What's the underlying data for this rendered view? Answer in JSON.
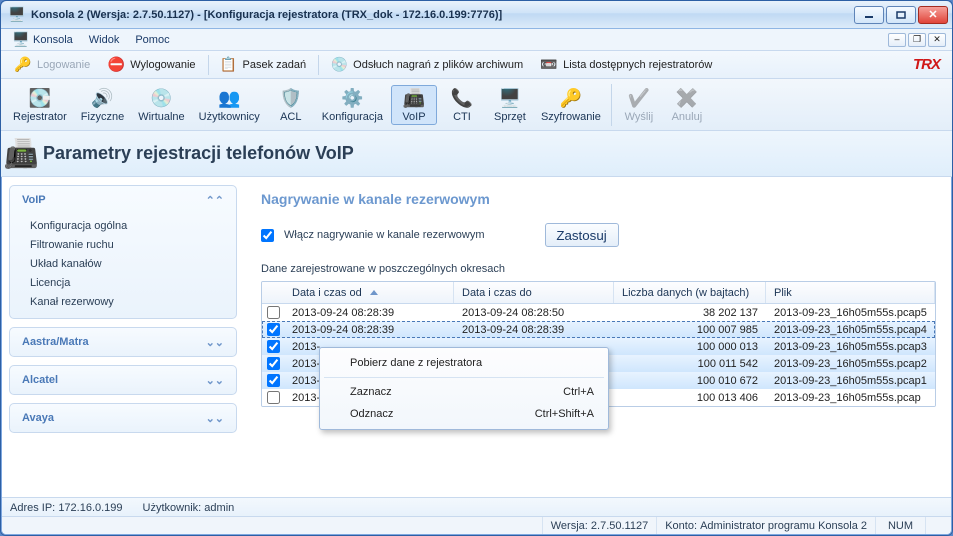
{
  "title": "Konsola 2 (Wersja:  2.7.50.1127) - [Konfiguracja rejestratora (TRX_dok - 172.16.0.199:7776)]",
  "menu": {
    "konsola": "Konsola",
    "widok": "Widok",
    "pomoc": "Pomoc"
  },
  "tb1": {
    "logowanie": "Logowanie",
    "wylogowanie": "Wylogowanie",
    "pasek": "Pasek zadań",
    "odsluch": "Odsłuch nagrań z plików archiwum",
    "lista": "Lista dostępnych rejestratorów"
  },
  "brand": "TRX",
  "tb2_items": [
    {
      "k": "rejestrator",
      "label": "Rejestrator",
      "ic": "💽"
    },
    {
      "k": "fizyczne",
      "label": "Fizyczne",
      "ic": "🔊"
    },
    {
      "k": "wirtualne",
      "label": "Wirtualne",
      "ic": "💿"
    },
    {
      "k": "uzytkownicy",
      "label": "Użytkownicy",
      "ic": "👥"
    },
    {
      "k": "acl",
      "label": "ACL",
      "ic": "🛡️"
    },
    {
      "k": "konfiguracja",
      "label": "Konfiguracja",
      "ic": "⚙️"
    },
    {
      "k": "voip",
      "label": "VoIP",
      "ic": "📠",
      "sel": true
    },
    {
      "k": "cti",
      "label": "CTI",
      "ic": "📞"
    },
    {
      "k": "sprzet",
      "label": "Sprzęt",
      "ic": "🖥️"
    },
    {
      "k": "szyfrowanie",
      "label": "Szyfrowanie",
      "ic": "🔑"
    }
  ],
  "tb2_right": [
    {
      "k": "wyslij",
      "label": "Wyślij",
      "ic": "✔️",
      "dis": true
    },
    {
      "k": "anuluj",
      "label": "Anuluj",
      "ic": "✖️",
      "dis": true
    }
  ],
  "header": "Parametry rejestracji telefonów VoIP",
  "sidebar": {
    "g1": {
      "title": "VoIP",
      "items": [
        "Konfiguracja ogólna",
        "Filtrowanie ruchu",
        "Układ kanałów",
        "Licencja",
        "Kanał rezerwowy"
      ]
    },
    "g2": {
      "title": "Aastra/Matra"
    },
    "g3": {
      "title": "Alcatel"
    },
    "g4": {
      "title": "Avaya"
    }
  },
  "section_title": "Nagrywanie w kanale rezerwowym",
  "chk_label": "Włącz nagrywanie w kanale rezerwowym",
  "apply_btn": "Zastosuj",
  "table_caption": "Dane zarejestrowane w poszczególnych okresach",
  "columns": {
    "c1": "Data i czas od",
    "c2": "Data i czas do",
    "c3": "Liczba danych (w bajtach)",
    "c4": "Plik"
  },
  "rows": [
    {
      "chk": false,
      "from": "2013-09-24 08:28:39",
      "to": "2013-09-24 08:28:50",
      "bytes": "38 202 137",
      "file": "2013-09-23_16h05m55s.pcap5",
      "sel": false
    },
    {
      "chk": true,
      "from": "2013-09-24 08:28:39",
      "to": "2013-09-24 08:28:39",
      "bytes": "100 007 985",
      "file": "2013-09-23_16h05m55s.pcap4",
      "sel": true,
      "foc": true
    },
    {
      "chk": true,
      "from": "2013-",
      "to": "",
      "bytes": "100 000 013",
      "file": "2013-09-23_16h05m55s.pcap3",
      "sel": true
    },
    {
      "chk": true,
      "from": "2013-",
      "to": "",
      "bytes": "100 011 542",
      "file": "2013-09-23_16h05m55s.pcap2",
      "sel": true
    },
    {
      "chk": true,
      "from": "2013-",
      "to": "",
      "bytes": "100 010 672",
      "file": "2013-09-23_16h05m55s.pcap1",
      "sel": true
    },
    {
      "chk": false,
      "from": "2013-",
      "to": "",
      "bytes": "100 013 406",
      "file": "2013-09-23_16h05m55s.pcap",
      "sel": false
    }
  ],
  "ctx": {
    "i1": "Pobierz dane z rejestratora",
    "i2": "Zaznacz",
    "s2": "Ctrl+A",
    "i3": "Odznacz",
    "s3": "Ctrl+Shift+A"
  },
  "status1": {
    "ip_lbl": "Adres IP:",
    "ip": "172.16.0.199",
    "user_lbl": "Użytkownik:",
    "user": "admin"
  },
  "status2": {
    "ver_lbl": "Wersja:",
    "ver": "2.7.50.1127",
    "konto_lbl": "Konto:",
    "konto": "Administrator programu Konsola 2",
    "num": "NUM"
  }
}
